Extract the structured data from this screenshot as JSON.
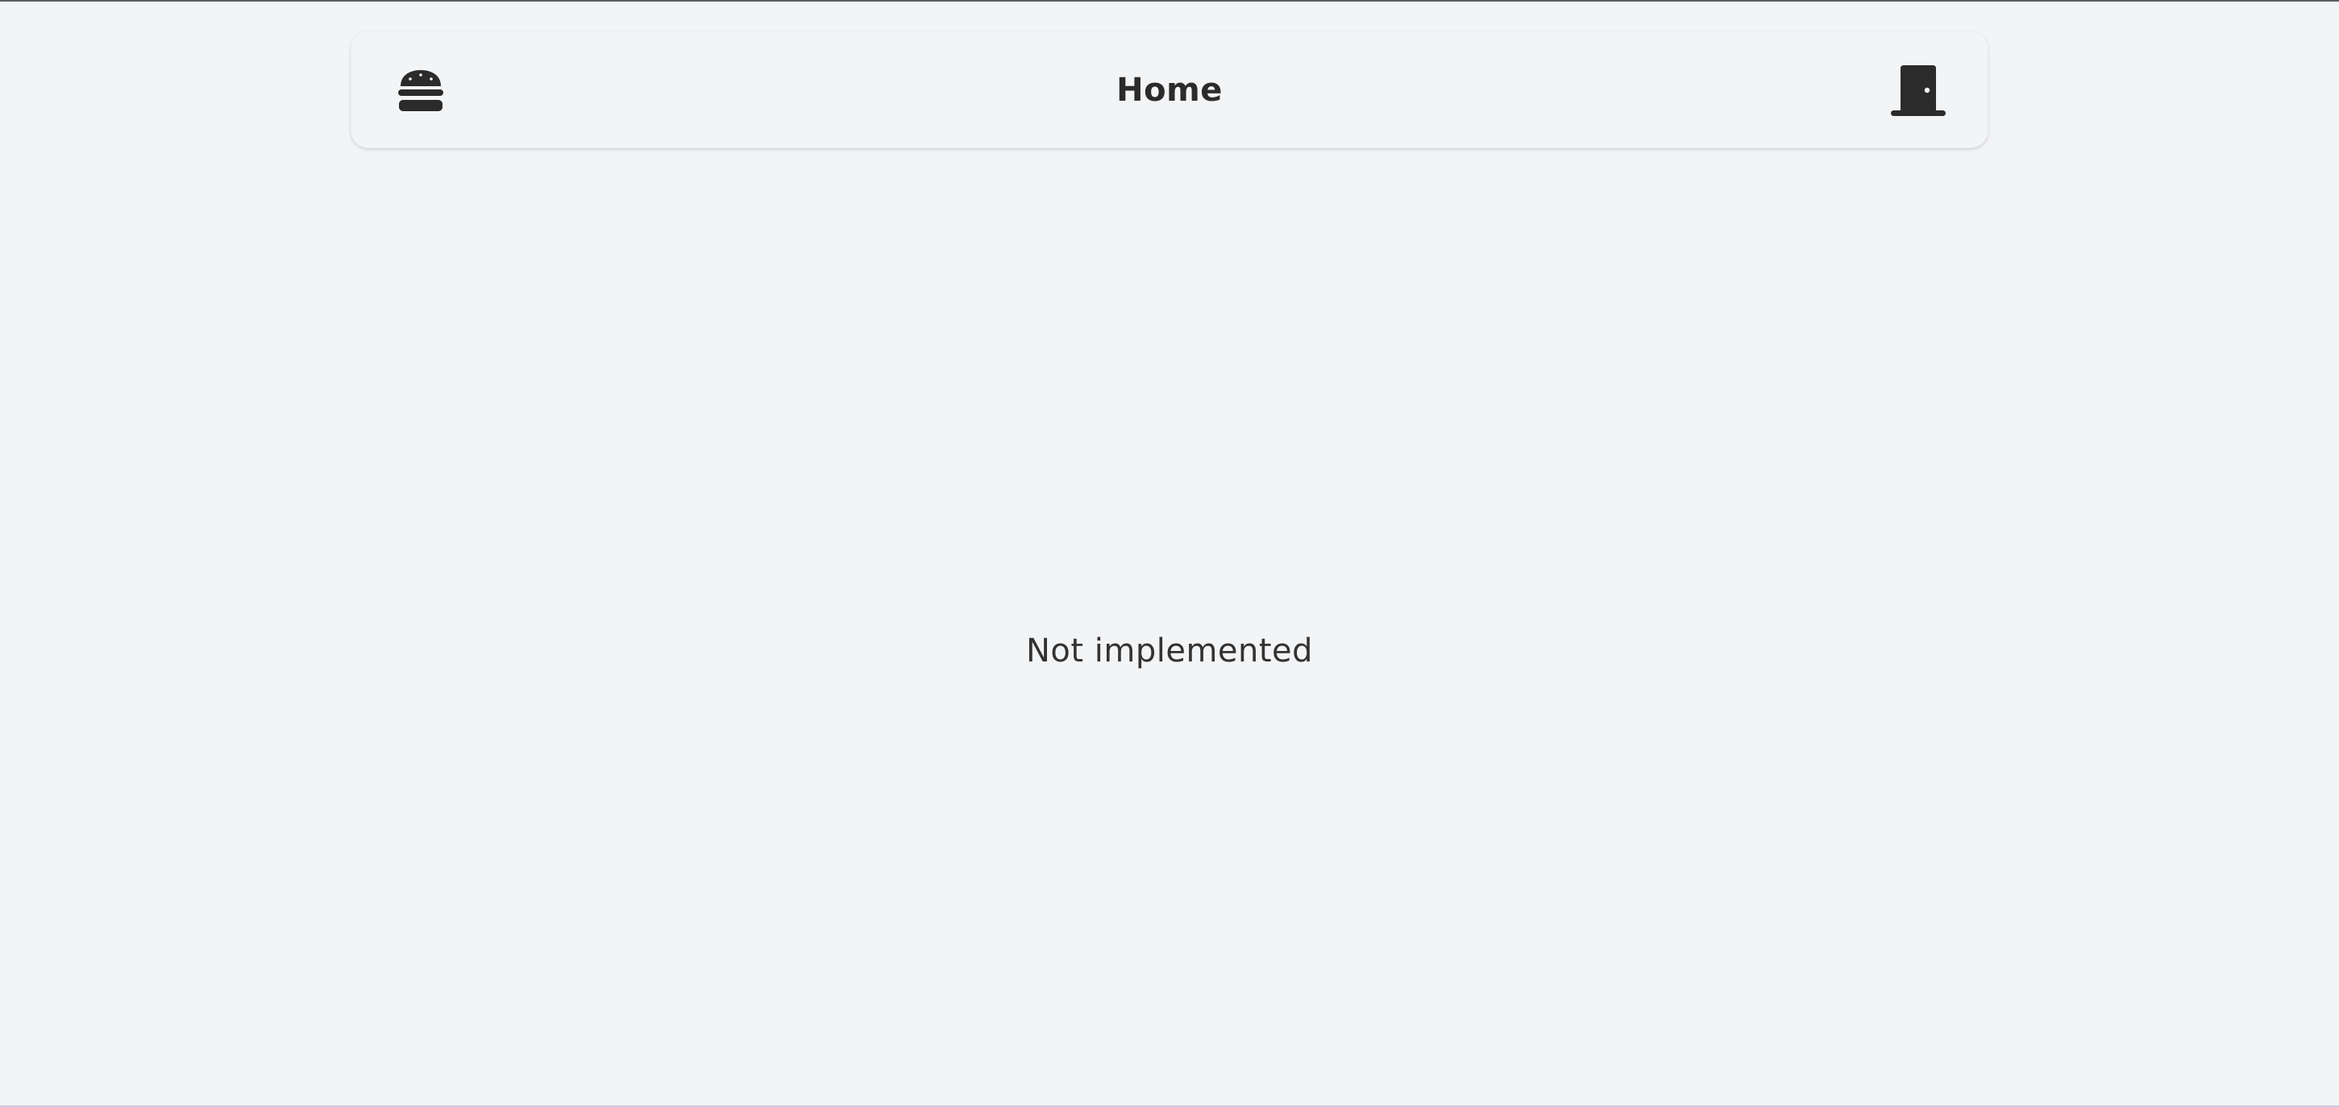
{
  "header": {
    "title": "Home",
    "menu_icon": "hamburger-food-icon",
    "exit_icon": "door-exit-icon"
  },
  "main": {
    "message": "Not implemented"
  },
  "colors": {
    "background": "#f3f4f6",
    "text": "#2b2b2b",
    "icon": "#2b2b2b"
  }
}
